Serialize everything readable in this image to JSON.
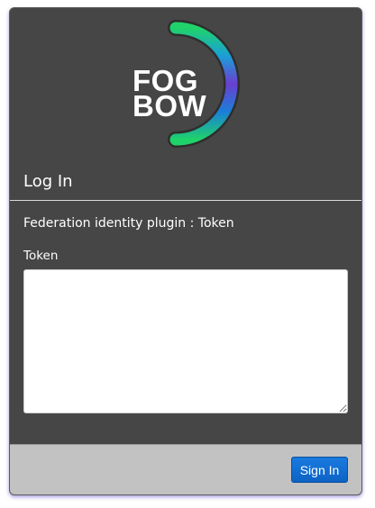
{
  "logo": {
    "line1": "FOG",
    "line2": "BOW",
    "icon": "fogbow-arc-logo"
  },
  "header": {
    "title": "Log In"
  },
  "form": {
    "plugin_text": "Federation identity plugin : Token",
    "token_label": "Token",
    "token_value": "",
    "token_placeholder": ""
  },
  "footer": {
    "signin_label": "Sign In"
  },
  "colors": {
    "card_background": "#464646",
    "footer_background": "#c2c2c2",
    "button_accent": "#0c63c4",
    "logo_arc_green": "#1fd36a",
    "logo_arc_purple": "#6a3fd0"
  }
}
